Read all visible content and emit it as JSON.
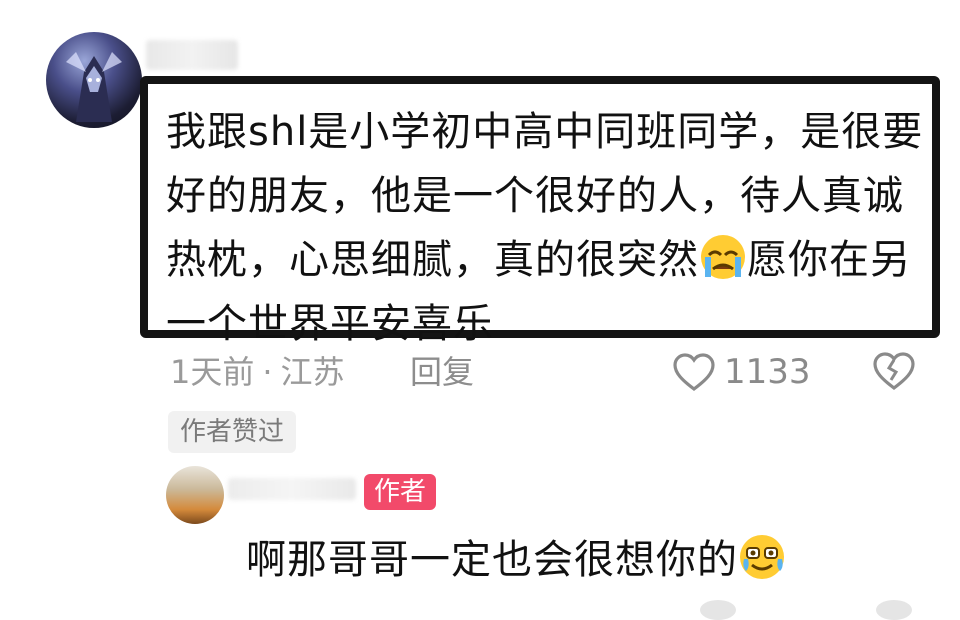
{
  "comment": {
    "text_before_emoji": "我跟shl是小学初中高中同班同学，是很要好的朋友，他是一个很好的人，待人真诚热枕，心思细腻，真的很突然",
    "text_after_emoji": "愿你在另一个世界平安喜乐",
    "emoji": "crying-face",
    "time": "1天前",
    "separator": "·",
    "location": "江苏",
    "reply_label": "回复",
    "like_count": "1133",
    "author_liked_label": "作者赞过"
  },
  "reply": {
    "author_badge": "作者",
    "text": "啊那哥哥一定也会很想你的",
    "emoji": "teary-smile-face"
  },
  "colors": {
    "badge": "#f24a6a",
    "meta_text": "#9a9a9a",
    "box_border": "#141414"
  }
}
